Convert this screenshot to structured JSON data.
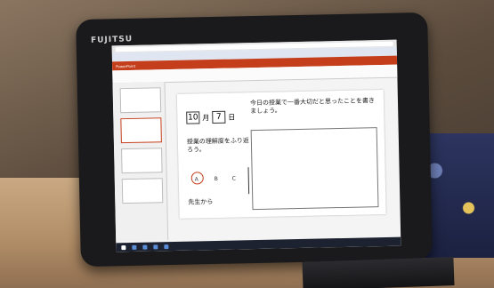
{
  "photo": {
    "brand_label": "FUJITSU"
  },
  "screen": {
    "app_bar": "PowerPoint",
    "slide": {
      "month": "10",
      "month_unit": "月",
      "day": "7",
      "day_unit": "日",
      "question": "授業の理解度をふり返ろう。",
      "options": [
        "A",
        "B",
        "C"
      ],
      "selected_option": "A",
      "teacher_label": "先生から",
      "prompt": "今日の授業で一番大切だと思ったことを書きましょう。"
    }
  },
  "colors": {
    "powerpoint_red": "#c43e1c",
    "selection_circle": "#c43e1c"
  }
}
